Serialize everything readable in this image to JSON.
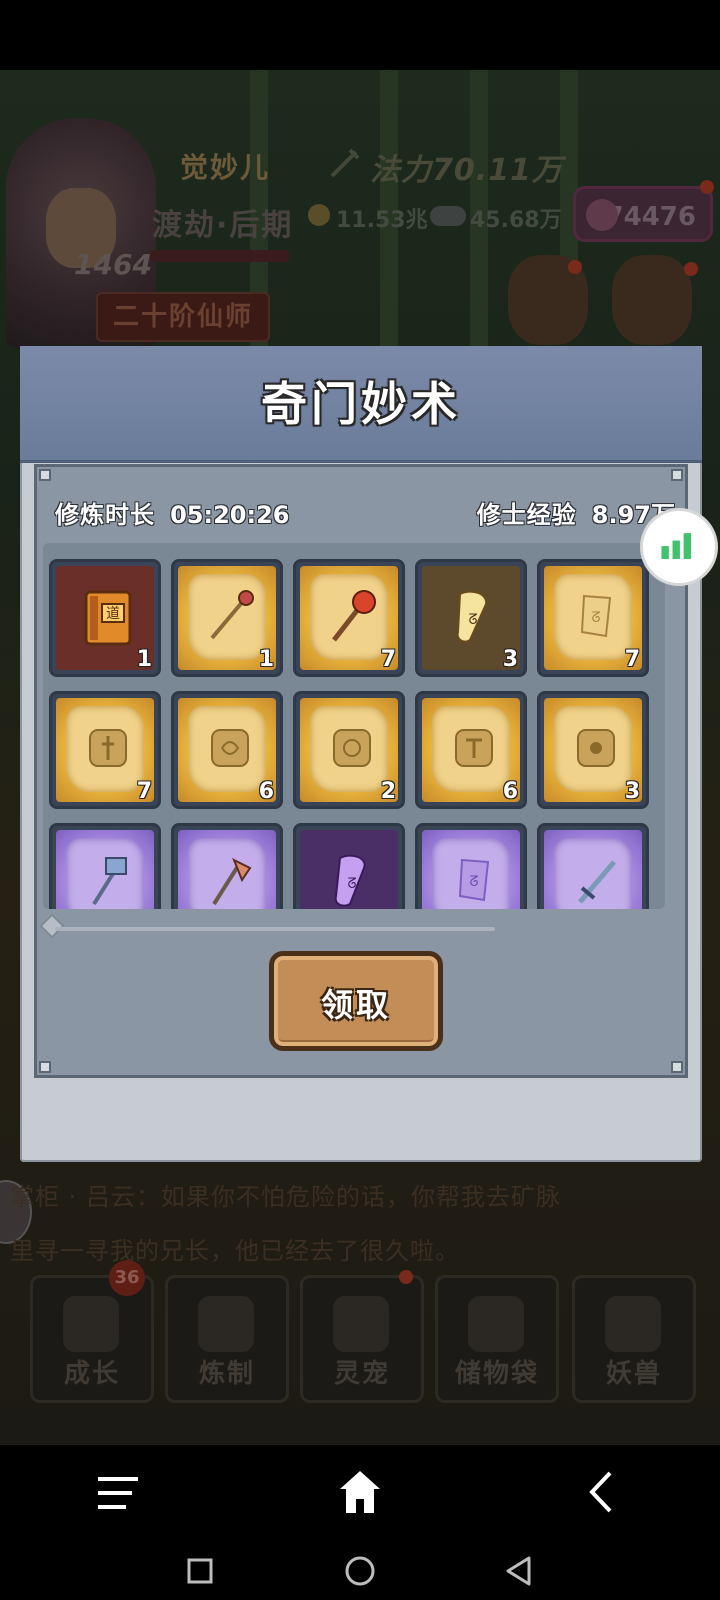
{
  "player": {
    "name": "觉妙儿",
    "realm": "渡劫·后期",
    "level": "1464",
    "rank": "二十阶仙师",
    "mana": "法力70.11万",
    "coins": "11.53兆",
    "spirit": "45.68万",
    "gems": "74476"
  },
  "modal": {
    "title": "奇门妙术",
    "train_time_label": "修炼时长",
    "train_time_value": "05:20:26",
    "exp_label": "修士经验",
    "exp_value": "8.97万",
    "claim_label": "领取"
  },
  "items": [
    {
      "icon": "dao-book-icon",
      "count": "1",
      "bg": "book"
    },
    {
      "icon": "golden-staff-scroll-icon",
      "count": "1",
      "bg": "gold"
    },
    {
      "icon": "flame-mace-scroll-icon",
      "count": "7",
      "bg": "gold"
    },
    {
      "icon": "golden-scroll-icon",
      "count": "3",
      "bg": "dark-gold"
    },
    {
      "icon": "scroll-fragment-icon",
      "count": "7",
      "bg": "gold"
    },
    {
      "icon": "sword-rune-stone-icon",
      "count": "7",
      "bg": "gold"
    },
    {
      "icon": "rune-stone-icon",
      "count": "6",
      "bg": "gold"
    },
    {
      "icon": "knot-rune-stone-icon",
      "count": "2",
      "bg": "gold"
    },
    {
      "icon": "hammer-rune-stone-icon",
      "count": "6",
      "bg": "gold"
    },
    {
      "icon": "sun-rune-stone-icon",
      "count": "3",
      "bg": "gold"
    },
    {
      "icon": "purple-hammer-icon",
      "count": "",
      "bg": "purple"
    },
    {
      "icon": "purple-axe-icon",
      "count": "",
      "bg": "purple"
    },
    {
      "icon": "purple-scroll-icon",
      "count": "",
      "bg": "dark-purple"
    },
    {
      "icon": "purple-scroll-fragment-icon",
      "count": "",
      "bg": "purple"
    },
    {
      "icon": "purple-sword-icon",
      "count": "",
      "bg": "purple"
    }
  ],
  "dialogue": {
    "line1": "掌柜 · 吕云：如果你不怕危险的话，你帮我去矿脉",
    "line2": "里寻一寻我的兄长，他已经去了很久啦。"
  },
  "bottom_nav": [
    {
      "label": "成长",
      "badge": "36"
    },
    {
      "label": "炼制",
      "badge": ""
    },
    {
      "label": "灵宠",
      "badge": ""
    },
    {
      "label": "储物袋",
      "badge": ""
    },
    {
      "label": "妖兽",
      "badge": ""
    }
  ],
  "colors": {
    "modal_header": "#6b7c9b",
    "panel": "#8a96a3",
    "gold_item_bg": "#e8b43c",
    "purple_item_bg": "#a789e2",
    "claim_button": "#c28d57"
  },
  "system_nav": {
    "menu": "menu-icon",
    "home": "home-icon",
    "back": "back-icon",
    "recents": "recents-icon",
    "circle": "circle-home-icon",
    "triangle": "triangle-back-icon"
  }
}
